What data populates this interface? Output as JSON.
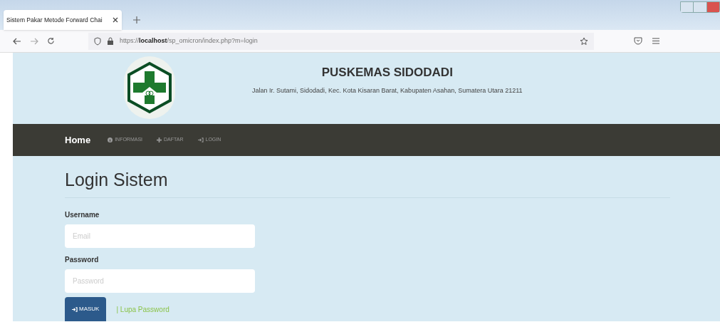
{
  "browser": {
    "tab_title": "Sistem Pakar Metode Forward Chai",
    "url_prefix": "https://",
    "url_host": "localhost",
    "url_path": "/sp_omicron/index.php?m=login"
  },
  "header": {
    "title": "PUSKEMAS SIDODADI",
    "address": "Jalan Ir. Sutami, Sidodadi, Kec. Kota Kisaran Barat, Kabupaten Asahan, Sumatera Utara 21211"
  },
  "nav": [
    {
      "label": "Home",
      "kind": "brand"
    },
    {
      "label": "INFORMASI",
      "kind": "info"
    },
    {
      "label": "DAFTAR",
      "kind": "plus"
    },
    {
      "label": "LOGIN",
      "kind": "login"
    }
  ],
  "page_title": "Login Sistem",
  "fields": [
    {
      "label": "Username",
      "placeholder": "Email"
    },
    {
      "label": "Password",
      "placeholder": "Password"
    }
  ],
  "submit": "MASUK",
  "forgot_separator": "|",
  "forgot_link": "Lupa Password"
}
